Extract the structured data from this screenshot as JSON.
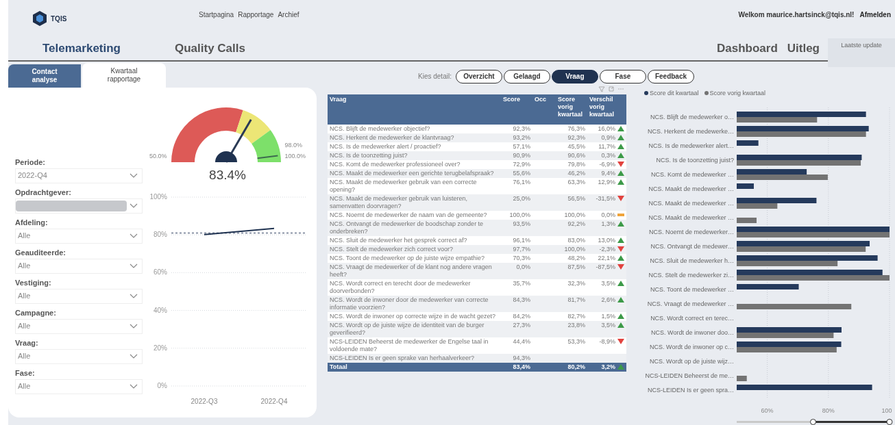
{
  "header": {
    "logo_text": "TQIS",
    "nav": [
      "Startpagina",
      "Rapportage",
      "Archief"
    ],
    "welcome": "Welkom maurice.hartsinck@tqis.nl!",
    "logout": "Afmelden"
  },
  "titles": {
    "left": [
      "Telemarketing",
      "Quality Calls"
    ],
    "right": [
      "Dashboard",
      "Uitleg"
    ],
    "update_label": "Laatste update"
  },
  "tabs": [
    {
      "label": "Contact analyse",
      "selected": false
    },
    {
      "label": "Kwartaal rapportage",
      "selected": true
    }
  ],
  "filters": [
    {
      "label": "Periode:",
      "kind": "value",
      "value": "2022-Q4"
    },
    {
      "label": "Opdrachtgever:",
      "kind": "redacted"
    },
    {
      "label": "Afdeling:",
      "kind": "value",
      "value": "Alle"
    },
    {
      "label": "Geauditeerde:",
      "kind": "value",
      "value": "Alle"
    },
    {
      "label": "Vestiging:",
      "kind": "value",
      "value": "Alle"
    },
    {
      "label": "Campagne:",
      "kind": "value",
      "value": "Alle"
    },
    {
      "label": "Vraag:",
      "kind": "value",
      "value": "Alle"
    },
    {
      "label": "Fase:",
      "kind": "value",
      "value": "Alle"
    }
  ],
  "gauge": {
    "value_text": "83.4%",
    "level": 0.668,
    "target": {
      "label": "98.0%",
      "level": 0.96
    },
    "min_label": "50.0%",
    "max_label": "100.0%"
  },
  "trend_chart": {
    "chart_data": {
      "type": "line",
      "grid": true,
      "x": [
        "2022-Q3",
        "2022-Q4"
      ],
      "ylim": [
        0,
        100
      ],
      "yticks": [
        {
          "value": 0,
          "label": "0%"
        },
        {
          "value": 20,
          "label": "20%"
        },
        {
          "value": 40,
          "label": "40%"
        },
        {
          "value": 60,
          "label": "60%"
        },
        {
          "value": 80,
          "label": "80%"
        },
        {
          "value": 100,
          "label": "100%"
        }
      ],
      "series": [
        {
          "color": "#1f3250",
          "values": [
            80.2,
            83.4
          ]
        }
      ],
      "ref_lines": [
        {
          "axis": "y",
          "value": 81
        }
      ]
    }
  },
  "detail": {
    "label": "Kies detail:",
    "options": [
      {
        "label": "Overzicht",
        "selected": false
      },
      {
        "label": "Gelaagd",
        "selected": false
      },
      {
        "label": "Vraag",
        "selected": true
      },
      {
        "label": "Fase",
        "selected": false
      },
      {
        "label": "Feedback",
        "selected": false
      }
    ]
  },
  "table": {
    "columns": [
      "Vraag",
      "Score",
      "Occ",
      "Score vorig kwartaal",
      "Verschil vorig kwartaal"
    ],
    "rows": [
      {
        "vraag": "NCS. Blijft de medewerker objectief?",
        "score": "92,3%",
        "prev": "76,3%",
        "diff": "16,0%",
        "kind": "up"
      },
      {
        "vraag": "NCS. Herkent de medewerker de klantvraag?",
        "score": "93,2%",
        "prev": "92,3%",
        "diff": "0,9%",
        "kind": "up"
      },
      {
        "vraag": "NCS. Is de medewerker alert / proactief?",
        "score": "57,1%",
        "prev": "45,5%",
        "diff": "11,7%",
        "kind": "up"
      },
      {
        "vraag": "NCS. Is de toonzetting juist?",
        "score": "90,9%",
        "prev": "90,6%",
        "diff": "0,3%",
        "kind": "up"
      },
      {
        "vraag": "NCS. Komt de medewerker professioneel over?",
        "score": "72,9%",
        "prev": "79,8%",
        "diff": "-6,9%",
        "kind": "down"
      },
      {
        "vraag": "NCS. Maakt de medewerker een gerichte terugbelafspraak?",
        "score": "55,6%",
        "prev": "46,2%",
        "diff": "9,4%",
        "kind": "up"
      },
      {
        "vraag": "NCS. Maakt de medewerker gebruik van een correcte opening?",
        "score": "76,1%",
        "prev": "63,3%",
        "diff": "12,9%",
        "kind": "up"
      },
      {
        "vraag": "NCS. Maakt de medewerker gebruik van luisteren, samenvatten doorvragen?",
        "score": "25,0%",
        "prev": "56,5%",
        "diff": "-31,5%",
        "kind": "down"
      },
      {
        "vraag": "NCS. Noemt de medewerker de naam van de gemeente?",
        "score": "100,0%",
        "prev": "100,0%",
        "diff": "0,0%",
        "kind": "flat"
      },
      {
        "vraag": "NCS. Ontvangt de medewerker de boodschap zonder te onderbreken?",
        "score": "93,5%",
        "prev": "92,2%",
        "diff": "1,3%",
        "kind": "up"
      },
      {
        "vraag": "NCS. Sluit de medewerker het gesprek correct af?",
        "score": "96,1%",
        "prev": "83,0%",
        "diff": "13,0%",
        "kind": "up"
      },
      {
        "vraag": "NCS. Stelt de medewerker zich correct voor?",
        "score": "97,7%",
        "prev": "100,0%",
        "diff": "-2,3%",
        "kind": "down"
      },
      {
        "vraag": "NCS. Toont de medewerker op de juiste wijze empathie?",
        "score": "70,3%",
        "prev": "48,2%",
        "diff": "22,1%",
        "kind": "up"
      },
      {
        "vraag": "NCS. Vraagt de medewerker of de klant nog andere vragen heeft?",
        "score": "0,0%",
        "prev": "87,5%",
        "diff": "-87,5%",
        "kind": "down"
      },
      {
        "vraag": "NCS. Wordt correct en terecht door de medewerker doorverbonden?",
        "score": "35,7%",
        "prev": "32,3%",
        "diff": "3,5%",
        "kind": "up"
      },
      {
        "vraag": "NCS. Wordt de inwoner door de medewerker van correcte informatie voorzien?",
        "score": "84,3%",
        "prev": "81,7%",
        "diff": "2,6%",
        "kind": "up"
      },
      {
        "vraag": "NCS. Wordt de inwoner op correcte wijze in de wacht gezet?",
        "score": "84,2%",
        "prev": "82,7%",
        "diff": "1,5%",
        "kind": "up"
      },
      {
        "vraag": "NCS. Wordt op de juiste wijze de identiteit van de burger geverifieerd?",
        "score": "27,3%",
        "prev": "23,8%",
        "diff": "3,5%",
        "kind": "up"
      },
      {
        "vraag": "NCS-LEIDEN Beheerst de medewerker de Engelse taal in voldoende mate?",
        "score": "44,4%",
        "prev": "53,3%",
        "diff": "-8,9%",
        "kind": "down"
      },
      {
        "vraag": "NCS-LEIDEN Is er geen sprake van herhaalverkeer?",
        "score": "94,3%"
      }
    ],
    "total": {
      "vraag": "Totaal",
      "score": "83,4%",
      "prev": "80,2%",
      "diff": "3,2%",
      "kind": "up"
    }
  },
  "bar_chart": {
    "chart_data": {
      "type": "bar",
      "orientation": "horizontal",
      "legend": true,
      "xlim": [
        50,
        100
      ],
      "xticks": [
        {
          "value": 60,
          "label": "60%"
        },
        {
          "value": 80,
          "label": "80%"
        },
        {
          "value": 100,
          "label": "100"
        }
      ],
      "categories": [
        "NCS. Blijft de medewerker o…",
        "NCS. Herkent de medewerke…",
        "NCS. Is de medewerker alert…",
        "NCS. Is de toonzetting juist?",
        "NCS. Komt de medewerker …",
        "NCS. Maakt de medewerker …",
        "NCS. Maakt de medewerker …",
        "NCS. Maakt de medewerker …",
        "NCS. Noemt de medewerker…",
        "NCS. Ontvangt de medewer…",
        "NCS. Sluit de medewerker h…",
        "NCS. Stelt de medewerker zi…",
        "NCS. Toont de medewerker …",
        "NCS. Vraagt de medewerker …",
        "NCS. Wordt correct en terec…",
        "NCS. Wordt de inwoner doo…",
        "NCS. Wordt de inwoner op c…",
        "NCS. Wordt op de juiste wijz…",
        "NCS-LEIDEN Beheerst de me…",
        "NCS-LEIDEN Is er geen spra…"
      ],
      "series": [
        {
          "name": "Score dit kwartaal",
          "color": "#253a5c",
          "values": [
            92.3,
            93.2,
            57.1,
            90.9,
            72.9,
            55.6,
            76.1,
            null,
            100.0,
            93.5,
            96.1,
            97.7,
            70.3,
            null,
            null,
            84.3,
            84.2,
            null,
            null,
            94.3
          ]
        },
        {
          "name": "Score vorig kwartaal",
          "color": "#737373",
          "values": [
            76.3,
            92.3,
            null,
            90.6,
            79.8,
            null,
            63.3,
            56.5,
            100.0,
            92.2,
            83.0,
            100.0,
            null,
            87.5,
            null,
            81.7,
            82.7,
            null,
            53.3,
            null
          ]
        }
      ]
    }
  }
}
